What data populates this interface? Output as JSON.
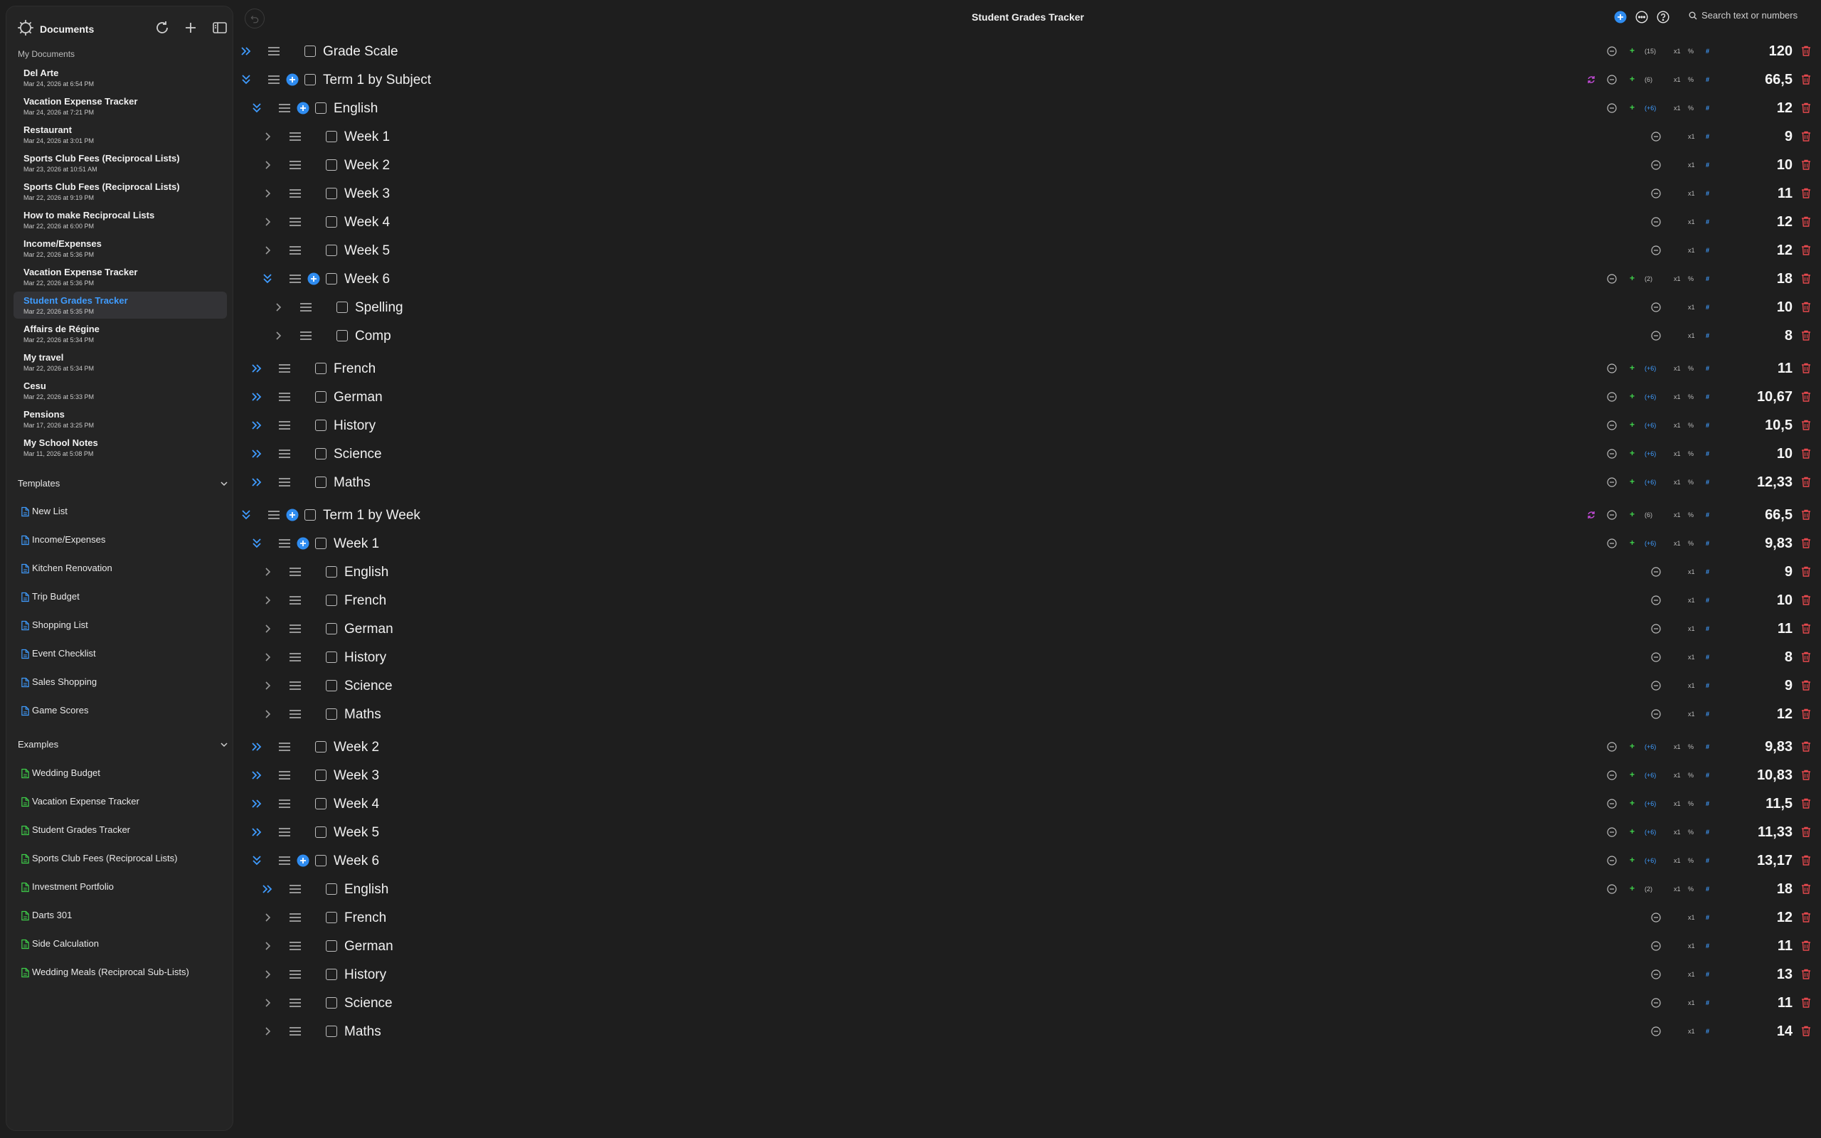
{
  "sidebar": {
    "title": "Documents",
    "my_documents_label": "My Documents",
    "documents": [
      {
        "name": "Del Arte",
        "date": "Mar 24, 2026 at 6:54 PM"
      },
      {
        "name": "Vacation Expense Tracker",
        "date": "Mar 24, 2026 at 7:21 PM"
      },
      {
        "name": "Restaurant",
        "date": "Mar 24, 2026 at 3:01 PM"
      },
      {
        "name": "Sports Club Fees (Reciprocal Lists)",
        "date": "Mar 23, 2026 at 10:51 AM"
      },
      {
        "name": "Sports Club Fees (Reciprocal Lists)",
        "date": "Mar 22, 2026 at 9:19 PM"
      },
      {
        "name": "How to make Reciprocal Lists",
        "date": "Mar 22, 2026 at 6:00 PM"
      },
      {
        "name": "Income/Expenses",
        "date": "Mar 22, 2026 at 5:36 PM"
      },
      {
        "name": "Vacation Expense Tracker",
        "date": "Mar 22, 2026 at 5:36 PM"
      },
      {
        "name": "Student Grades Tracker",
        "date": "Mar 22, 2026 at 5:35 PM"
      },
      {
        "name": "Affairs de Régine",
        "date": "Mar 22, 2026 at 5:34 PM"
      },
      {
        "name": "My travel",
        "date": "Mar 22, 2026 at 5:34 PM"
      },
      {
        "name": "Cesu",
        "date": "Mar 22, 2026 at 5:33 PM"
      },
      {
        "name": "Pensions",
        "date": "Mar 17, 2026 at 3:25 PM"
      },
      {
        "name": "My School Notes",
        "date": "Mar 11, 2026 at 5:08 PM"
      }
    ],
    "templates_label": "Templates",
    "templates": [
      "New List",
      "Income/Expenses",
      "Kitchen Renovation",
      "Trip Budget",
      "Shopping List",
      "Event Checklist",
      "Sales Shopping",
      "Game Scores"
    ],
    "examples_label": "Examples",
    "examples": [
      "Wedding Budget",
      "Vacation Expense Tracker",
      "Student Grades Tracker",
      "Sports Club Fees (Reciprocal Lists)",
      "Investment Portfolio",
      "Darts 301",
      "Side Calculation",
      "Wedding Meals (Reciprocal Sub-Lists)"
    ]
  },
  "header": {
    "title": "Student Grades Tracker",
    "search_placeholder": "Search text or numbers"
  },
  "rows": [
    {
      "label": "Grade Scale",
      "value": "120",
      "count": "(15)",
      "count_blue": false,
      "level": 0,
      "expand": "double-right",
      "add": false,
      "group": true,
      "sync": false
    },
    {
      "label": "Term 1 by Subject",
      "value": "66,5",
      "count": "(6)",
      "count_blue": false,
      "level": 0,
      "expand": "double-down",
      "add": true,
      "group": true,
      "sync": true
    },
    {
      "label": "English",
      "value": "12",
      "count": "(+6)",
      "count_blue": true,
      "level": 1,
      "expand": "double-down",
      "add": true,
      "group": true,
      "sync": false
    },
    {
      "label": "Week 1",
      "value": "9",
      "level": 2,
      "expand": "single-right",
      "add": false,
      "group": false
    },
    {
      "label": "Week 2",
      "value": "10",
      "level": 2,
      "expand": "single-right",
      "add": false,
      "group": false
    },
    {
      "label": "Week 3",
      "value": "11",
      "level": 2,
      "expand": "single-right",
      "add": false,
      "group": false
    },
    {
      "label": "Week 4",
      "value": "12",
      "level": 2,
      "expand": "single-right",
      "add": false,
      "group": false
    },
    {
      "label": "Week 5",
      "value": "12",
      "level": 2,
      "expand": "single-right",
      "add": false,
      "group": false
    },
    {
      "label": "Week 6",
      "value": "18",
      "count": "(2)",
      "count_blue": false,
      "level": 2,
      "expand": "double-down",
      "add": true,
      "group": true,
      "sync": false
    },
    {
      "label": "Spelling",
      "value": "10",
      "level": 3,
      "expand": "single-right",
      "add": false,
      "group": false
    },
    {
      "label": "Comp",
      "value": "8",
      "level": 3,
      "expand": "single-right",
      "add": false,
      "group": false
    },
    {
      "label": "French",
      "value": "11",
      "count": "(+6)",
      "count_blue": true,
      "level": 1,
      "expand": "double-right",
      "add": false,
      "group": true,
      "sync": false
    },
    {
      "label": "German",
      "value": "10,67",
      "count": "(+6)",
      "count_blue": true,
      "level": 1,
      "expand": "double-right",
      "add": false,
      "group": true,
      "sync": false
    },
    {
      "label": "History",
      "value": "10,5",
      "count": "(+6)",
      "count_blue": true,
      "level": 1,
      "expand": "double-right",
      "add": false,
      "group": true,
      "sync": false
    },
    {
      "label": "Science",
      "value": "10",
      "count": "(+6)",
      "count_blue": true,
      "level": 1,
      "expand": "double-right",
      "add": false,
      "group": true,
      "sync": false
    },
    {
      "label": "Maths",
      "value": "12,33",
      "count": "(+6)",
      "count_blue": true,
      "level": 1,
      "expand": "double-right",
      "add": false,
      "group": true,
      "sync": false
    },
    {
      "label": "Term 1 by Week",
      "value": "66,5",
      "count": "(6)",
      "count_blue": false,
      "level": 0,
      "expand": "double-down",
      "add": true,
      "group": true,
      "sync": true
    },
    {
      "label": "Week 1",
      "value": "9,83",
      "count": "(+6)",
      "count_blue": true,
      "level": 1,
      "expand": "double-down",
      "add": true,
      "group": true,
      "sync": false
    },
    {
      "label": "English",
      "value": "9",
      "level": 2,
      "expand": "single-right",
      "add": false,
      "group": false
    },
    {
      "label": "French",
      "value": "10",
      "level": 2,
      "expand": "single-right",
      "add": false,
      "group": false
    },
    {
      "label": "German",
      "value": "11",
      "level": 2,
      "expand": "single-right",
      "add": false,
      "group": false
    },
    {
      "label": "History",
      "value": "8",
      "level": 2,
      "expand": "single-right",
      "add": false,
      "group": false
    },
    {
      "label": "Science",
      "value": "9",
      "level": 2,
      "expand": "single-right",
      "add": false,
      "group": false
    },
    {
      "label": "Maths",
      "value": "12",
      "level": 2,
      "expand": "single-right",
      "add": false,
      "group": false
    },
    {
      "label": "Week 2",
      "value": "9,83",
      "count": "(+6)",
      "count_blue": true,
      "level": 1,
      "expand": "double-right",
      "add": false,
      "group": true,
      "sync": false
    },
    {
      "label": "Week 3",
      "value": "10,83",
      "count": "(+6)",
      "count_blue": true,
      "level": 1,
      "expand": "double-right",
      "add": false,
      "group": true,
      "sync": false
    },
    {
      "label": "Week 4",
      "value": "11,5",
      "count": "(+6)",
      "count_blue": true,
      "level": 1,
      "expand": "double-right",
      "add": false,
      "group": true,
      "sync": false
    },
    {
      "label": "Week 5",
      "value": "11,33",
      "count": "(+6)",
      "count_blue": true,
      "level": 1,
      "expand": "double-right",
      "add": false,
      "group": true,
      "sync": false
    },
    {
      "label": "Week 6",
      "value": "13,17",
      "count": "(+6)",
      "count_blue": true,
      "level": 1,
      "expand": "double-down",
      "add": true,
      "group": true,
      "sync": false
    },
    {
      "label": "English",
      "value": "18",
      "count": "(2)",
      "count_blue": false,
      "level": 2,
      "expand": "double-right",
      "add": false,
      "group": true,
      "sync": false
    },
    {
      "label": "French",
      "value": "12",
      "level": 2,
      "expand": "single-right",
      "add": false,
      "group": false
    },
    {
      "label": "German",
      "value": "11",
      "level": 2,
      "expand": "single-right",
      "add": false,
      "group": false
    },
    {
      "label": "History",
      "value": "13",
      "level": 2,
      "expand": "single-right",
      "add": false,
      "group": false
    },
    {
      "label": "Science",
      "value": "11",
      "level": 2,
      "expand": "single-right",
      "add": false,
      "group": false
    },
    {
      "label": "Maths",
      "value": "14",
      "level": 2,
      "expand": "single-right",
      "add": false,
      "group": false
    }
  ],
  "controls": {
    "x1": "x1",
    "pct": "%",
    "hash": "#",
    "plus": "+"
  },
  "colors": {
    "accent": "#3f9cff",
    "plus": "#3ecf4a",
    "trash": "#e5484d",
    "sync": "#c34bd8",
    "background": "#1e1e1e",
    "sidebar": "#242424"
  }
}
